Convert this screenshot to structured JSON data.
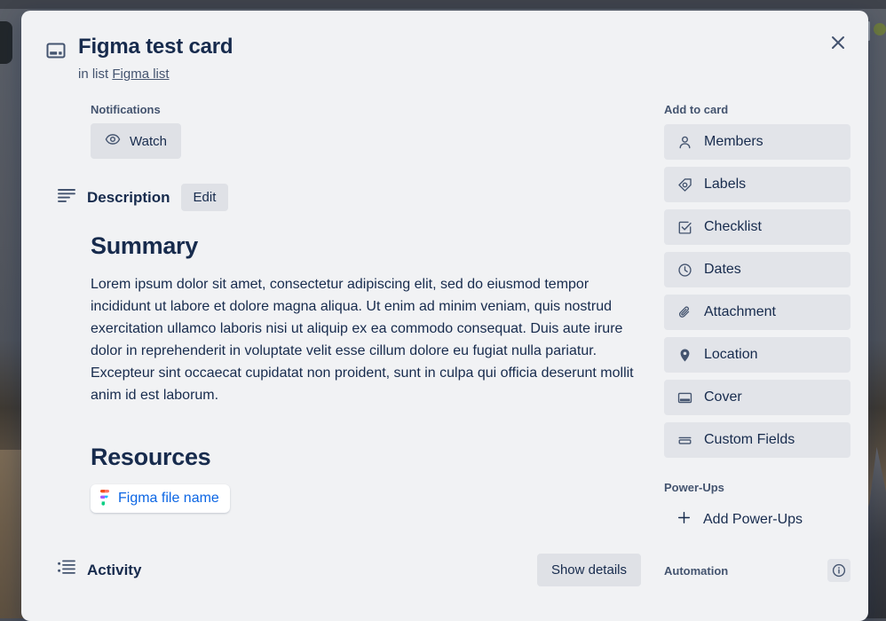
{
  "modal": {
    "close_icon": "close-icon"
  },
  "header": {
    "card_icon": "card-icon",
    "title": "Figma test card",
    "in_list_prefix": "in list",
    "list_name": "Figma list"
  },
  "notifications": {
    "label": "Notifications",
    "watch_label": "Watch",
    "watch_icon": "eye-icon"
  },
  "description": {
    "icon": "description-lines-icon",
    "title": "Description",
    "edit_label": "Edit",
    "summary_heading": "Summary",
    "summary_text": "Lorem ipsum dolor sit amet, consectetur adipiscing elit, sed do eiusmod tempor incididunt ut labore et dolore magna aliqua. Ut enim ad minim veniam, quis nostrud exercitation ullamco laboris nisi ut aliquip ex ea commodo consequat. Duis aute irure dolor in reprehenderit in voluptate velit esse cillum dolore eu fugiat nulla pariatur. Excepteur sint occaecat cupidatat non proident, sunt in culpa qui officia deserunt mollit anim id est laborum.",
    "resources_heading": "Resources",
    "figma_link_label": "Figma file name",
    "figma_icon": "figma-logo-icon"
  },
  "activity": {
    "icon": "activity-list-icon",
    "title": "Activity",
    "show_details_label": "Show details"
  },
  "sidebar": {
    "add_to_card_heading": "Add to card",
    "items": [
      {
        "label": "Members",
        "icon": "person-icon"
      },
      {
        "label": "Labels",
        "icon": "label-tag-icon"
      },
      {
        "label": "Checklist",
        "icon": "checkbox-checked-icon"
      },
      {
        "label": "Dates",
        "icon": "clock-icon"
      },
      {
        "label": "Attachment",
        "icon": "paperclip-icon"
      },
      {
        "label": "Location",
        "icon": "location-pin-icon"
      },
      {
        "label": "Cover",
        "icon": "cover-card-icon"
      },
      {
        "label": "Custom Fields",
        "icon": "custom-fields-icon"
      }
    ],
    "powerups_heading": "Power-Ups",
    "add_powerups_label": "Add Power-Ups",
    "add_powerups_icon": "plus-icon",
    "automation_heading": "Automation",
    "automation_info_icon": "info-icon"
  },
  "colors": {
    "modal_background": "#f1f2f4",
    "button_background": "#e2e4e9",
    "text_primary": "#172b4d",
    "text_subtle": "#44546f",
    "link_blue": "#0c66e4"
  }
}
